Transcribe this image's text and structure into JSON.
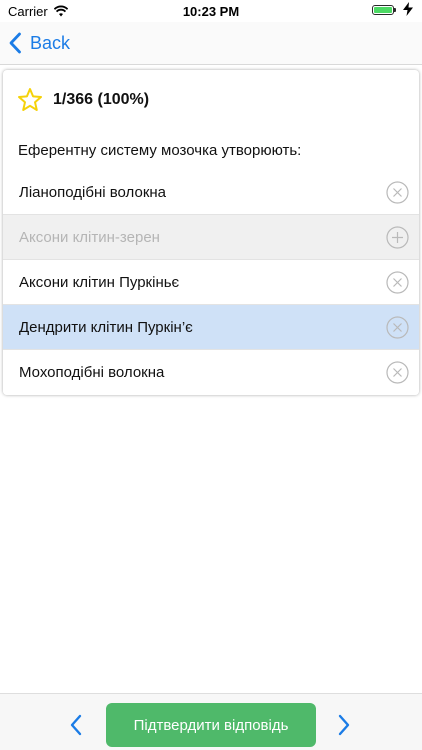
{
  "status_bar": {
    "carrier": "Carrier",
    "time": "10:23 PM"
  },
  "nav": {
    "back_label": "Back"
  },
  "quiz": {
    "score": "1/366 (100%)",
    "question": "Еферентну систему мозочка утворюють:",
    "options": [
      {
        "label": "Ліаноподібні волокна",
        "state": "default",
        "icon": "close-circle-icon"
      },
      {
        "label": "Аксони клітин-зерен",
        "state": "disabled",
        "icon": "add-circle-icon"
      },
      {
        "label": "Аксони клітин Пуркіньє",
        "state": "default",
        "icon": "close-circle-icon"
      },
      {
        "label": "Дендрити клітин Пуркін’є",
        "state": "selected",
        "icon": "close-circle-icon"
      },
      {
        "label": "Мохоподібні волокна",
        "state": "default",
        "icon": "close-circle-icon"
      }
    ]
  },
  "toolbar": {
    "confirm_label": "Підтвердити відповідь"
  },
  "colors": {
    "accent": "#1b7ce6",
    "confirm": "#4fb96a",
    "selected_row": "#cfe1f7",
    "disabled_row": "#f0f0f0",
    "star": "#f5d20a",
    "battery": "#4cd964"
  }
}
